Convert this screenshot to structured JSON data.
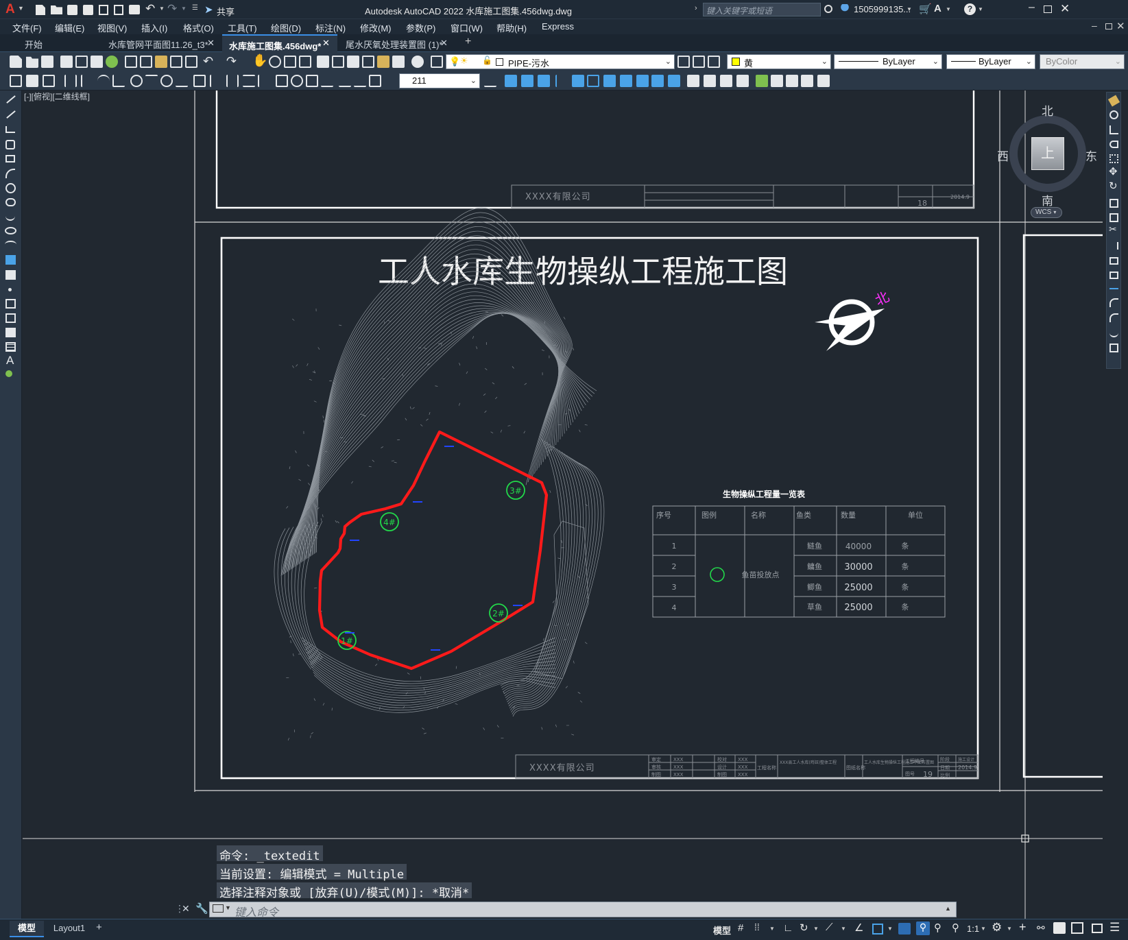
{
  "app": {
    "logo": "A",
    "share_label": "共享",
    "title": "Autodesk AutoCAD 2022    水库施工图集.456dwg.dwg",
    "search_placeholder": "键入关键字或短语",
    "user": "1505999135...",
    "help": "?"
  },
  "menu": [
    "文件(F)",
    "编辑(E)",
    "视图(V)",
    "插入(I)",
    "格式(O)",
    "工具(T)",
    "绘图(D)",
    "标注(N)",
    "修改(M)",
    "参数(P)",
    "窗口(W)",
    "帮助(H)",
    "Express"
  ],
  "tabs": [
    {
      "label": "开始",
      "active": false,
      "closable": false
    },
    {
      "label": "水库管网平面图11.26_t3*",
      "active": false,
      "closable": true
    },
    {
      "label": "水库施工图集.456dwg*",
      "active": true,
      "closable": true
    },
    {
      "label": "尾水厌氧处理装置图 (1)*",
      "active": false,
      "closable": true
    }
  ],
  "toolbar": {
    "layer": "PIPE-污水",
    "color": "黄",
    "linetype": "ByLayer",
    "lineweight": "ByLayer",
    "plotstyle": "ByColor",
    "dimstyle_value": "211"
  },
  "viewport_label": "[-][俯视][二维线框]",
  "viewcube": {
    "north": "北",
    "south": "南",
    "east": "东",
    "west": "西",
    "top": "上",
    "wcs": "WCS"
  },
  "drawing": {
    "title": "工人水库生物操纵工程施工图",
    "north_label": "北",
    "company": "XXXX有限公司",
    "top_company": "XXXX有限公司",
    "sheet_no": "19",
    "top_sheet_no": "18",
    "date": "2014.9",
    "points": [
      "1#",
      "2#",
      "3#",
      "4#"
    ],
    "table": {
      "title": "生物操纵工程量一览表",
      "headers": [
        "序号",
        "图例",
        "名称",
        "鱼类",
        "数量",
        "单位"
      ],
      "rows": [
        {
          "no": "1",
          "fish": "鲢鱼",
          "qty": "40000",
          "unit": "条"
        },
        {
          "no": "2",
          "fish": "鳙鱼",
          "qty": "30000",
          "unit": "条"
        },
        {
          "no": "3",
          "fish": "鲫鱼",
          "qty": "25000",
          "unit": "条"
        },
        {
          "no": "4",
          "fish": "草鱼",
          "qty": "25000",
          "unit": "条"
        }
      ],
      "name_cell": "鱼苗投放点"
    },
    "titleblock": {
      "review": "审定",
      "check": "审核",
      "design": "设计",
      "draw": "制图",
      "proof": "校对",
      "xxx": "XXX",
      "project": "工程名称",
      "drawing_name": "图纸名称",
      "project_no": "工程编号",
      "sheet": "图号",
      "phase": "阶段",
      "date_label": "日期",
      "scale": "比例",
      "phase_value": "施工设计",
      "project_desc": "XXX县工人水库(鸡钰)整体工程",
      "drawing_desc": "工人水库生物操纵工程施工平面布置图"
    }
  },
  "command": {
    "history": [
      "命令: _textedit",
      "当前设置: 编辑模式 = Multiple",
      "选择注释对象或 [放弃(U)/模式(M)]: *取消*"
    ],
    "placeholder": "键入命令"
  },
  "layout_tabs": [
    "模型",
    "Layout1"
  ],
  "status": {
    "model": "模型",
    "scale": "1:1"
  }
}
